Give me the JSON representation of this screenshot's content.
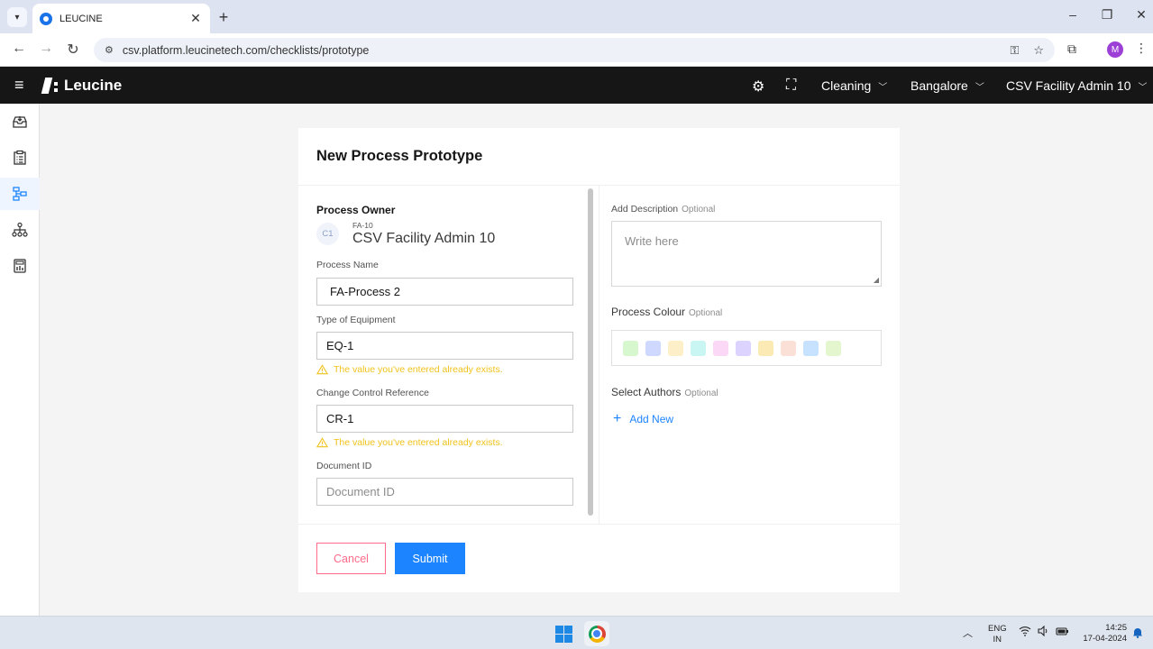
{
  "browser": {
    "tab_title": "LEUCINE",
    "url": "csv.platform.leucinetech.com/checklists/prototype",
    "profile_initial": "M"
  },
  "header": {
    "logo_text": "Leucine",
    "use_case": "Cleaning",
    "facility": "Bangalore",
    "user": "CSV Facility Admin 10"
  },
  "sidebar": {
    "items": [
      {
        "icon": "inbox-icon"
      },
      {
        "icon": "checklist-icon"
      },
      {
        "icon": "prototype-icon"
      },
      {
        "icon": "hierarchy-icon"
      },
      {
        "icon": "calculator-icon"
      }
    ],
    "active_index": 2
  },
  "form": {
    "title": "New Process Prototype",
    "owner_label": "Process Owner",
    "owner_avatar": "C1",
    "owner_id": "FA-10",
    "owner_name": "CSV Facility Admin 10",
    "process_name_label": "Process Name",
    "process_name_value": "FA-Process 2",
    "equipment_label": "Type of Equipment",
    "equipment_value": "EQ-1",
    "equipment_warning": "The value you've entered already exists.",
    "change_control_label": "Change Control Reference",
    "change_control_value": "CR-1",
    "change_control_warning": "The value you've entered already exists.",
    "document_id_label": "Document ID",
    "document_id_placeholder": "Document ID",
    "description_label": "Add Description",
    "description_optional": "Optional",
    "description_placeholder": "Write here",
    "colour_label": "Process Colour",
    "colour_optional": "Optional",
    "colours": [
      "#d7f7cf",
      "#cfd8ff",
      "#fdf0c8",
      "#c9f6f2",
      "#fbd9f6",
      "#dcd3ff",
      "#fbeab4",
      "#fbe0d8",
      "#c6e2ff",
      "#e3f6cd"
    ],
    "authors_label": "Select Authors",
    "authors_optional": "Optional",
    "add_new": "Add New",
    "cancel": "Cancel",
    "submit": "Submit"
  },
  "taskbar": {
    "lang_1": "ENG",
    "lang_2": "IN",
    "time": "14:25",
    "date": "17-04-2024"
  },
  "colors": {
    "accent": "#1d84ff",
    "warning": "#f1c21b",
    "danger": "#ff6b8a"
  }
}
